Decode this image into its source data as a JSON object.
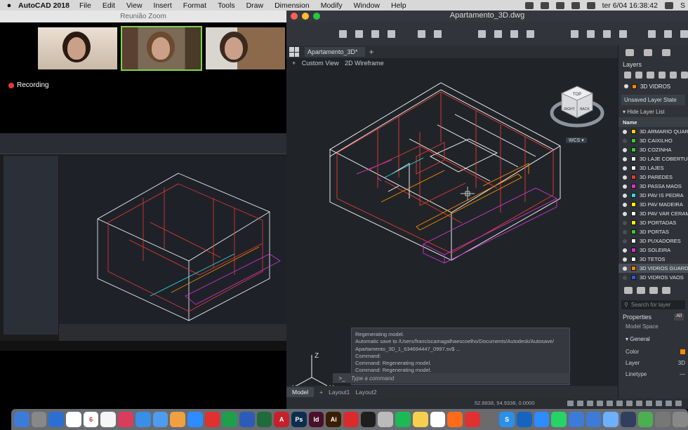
{
  "menubar": {
    "app_name": "AutoCAD 2018",
    "menus": [
      "File",
      "Edit",
      "View",
      "Insert",
      "Format",
      "Tools",
      "Draw",
      "Dimension",
      "Modify",
      "Window",
      "Help"
    ],
    "datetime": "ter 6/04  16:38:42",
    "user": "S"
  },
  "zoom": {
    "title": "Reunião Zoom",
    "recording_label": "Recording"
  },
  "acad": {
    "window_title": "Apartamento_3D.dwg",
    "tab_name": "Apartamento_3D*",
    "viewport_labels": [
      "Custom View",
      "2D Wireframe"
    ],
    "viewcube_top": "TOP",
    "viewcube_front": "FRONT",
    "viewcube_right": "RIGHT",
    "viewcube_back": "BACK",
    "wcs": "WCS",
    "ucs_x": "X",
    "ucs_y": "Y",
    "ucs_z": "Z",
    "command_history": [
      "Regenerating model.",
      "Automatic save to /Users/franciscamagalhaescoelho/Documents/Autodesk/Autosave/",
      "Apartamento_3D_1_634694447_0997.sv$ ...",
      "Command:",
      "Command:  Regenerating model.",
      "Command:  Regenerating model."
    ],
    "command_placeholder": "Type a command",
    "layout_tabs": [
      "Model",
      "Layout1",
      "Layout2"
    ],
    "coords": "52.8838, 54.9338, 0.0000"
  },
  "layers": {
    "title": "Layers",
    "current_layer": "3D VIDROS",
    "layer_state": "Unsaved Layer State",
    "hide_list": "Hide Layer List",
    "name_header": "Name",
    "items": [
      {
        "name": "3D ARMARIO QUAR",
        "color": "#ffcc00",
        "on": true
      },
      {
        "name": "3D CAIXILHO",
        "color": "#33cc33",
        "on": false
      },
      {
        "name": "3D COZINHA",
        "color": "#33cc33",
        "on": true
      },
      {
        "name": "3D LAJE COBERTUR",
        "color": "#ffffff",
        "on": true
      },
      {
        "name": "3D LAJES",
        "color": "#ffffff",
        "on": true
      },
      {
        "name": "3D PAREDES",
        "color": "#e53935",
        "on": true
      },
      {
        "name": "3D PASSA MAOS",
        "color": "#d633d6",
        "on": true
      },
      {
        "name": "3D PAV IS PEDRA",
        "color": "#33d6e0",
        "on": true
      },
      {
        "name": "3D PAV MADEIRA",
        "color": "#ffee00",
        "on": true
      },
      {
        "name": "3D PAV VAR CERAM",
        "color": "#ffffff",
        "on": true
      },
      {
        "name": "3D PORTADAS",
        "color": "#ffee00",
        "on": false
      },
      {
        "name": "3D PORTAS",
        "color": "#33cc33",
        "on": false
      },
      {
        "name": "3D PUXADORES",
        "color": "#ffffff",
        "on": false
      },
      {
        "name": "3D SOLEIRA",
        "color": "#d633d6",
        "on": true
      },
      {
        "name": "3D TETOS",
        "color": "#ffffff",
        "on": true
      },
      {
        "name": "3D VIDROS GUARD",
        "color": "#ff8800",
        "on": true,
        "selected": true
      },
      {
        "name": "3D VIDROS VAOS",
        "color": "#2f5bd6",
        "on": false
      }
    ],
    "search_placeholder": "Search for layer"
  },
  "properties": {
    "title": "Properties",
    "all_label": "All",
    "model_space": "Model Space",
    "general": "General",
    "rows": [
      {
        "label": "Color",
        "value": ""
      },
      {
        "label": "Layer",
        "value": "3D"
      },
      {
        "label": "Linetype",
        "value": "—"
      }
    ]
  },
  "dock": {
    "apps": [
      {
        "label": "",
        "color": "#3d7bd9"
      },
      {
        "label": "",
        "color": "#888"
      },
      {
        "label": "",
        "color": "#2b6fd1"
      },
      {
        "label": "",
        "color": "#ffffff"
      },
      {
        "label": "6",
        "color": "#ffffff"
      },
      {
        "label": "",
        "color": "#f5f5f5"
      },
      {
        "label": "",
        "color": "#d93d5d"
      },
      {
        "label": "",
        "color": "#3a8ee6"
      },
      {
        "label": "",
        "color": "#4d9cf0"
      },
      {
        "label": "",
        "color": "#f0a040"
      },
      {
        "label": "",
        "color": "#2d8cff"
      },
      {
        "label": "",
        "color": "#e03030"
      },
      {
        "label": "",
        "color": "#1f9e4b"
      },
      {
        "label": "",
        "color": "#2b5cb8"
      },
      {
        "label": "",
        "color": "#1f6b3a"
      },
      {
        "label": "A",
        "color": "#c8202a"
      },
      {
        "label": "Ps",
        "color": "#0c2d4e"
      },
      {
        "label": "Id",
        "color": "#4a0f2a"
      },
      {
        "label": "Ai",
        "color": "#3a1e02"
      },
      {
        "label": "",
        "color": "#d92b2b"
      },
      {
        "label": "",
        "color": "#1e1e1e"
      },
      {
        "label": "",
        "color": "#bbbbbb"
      },
      {
        "label": "",
        "color": "#1db954"
      },
      {
        "label": "",
        "color": "#f6d04d"
      },
      {
        "label": "",
        "color": "#ffffff"
      },
      {
        "label": "",
        "color": "#ff6b1a"
      },
      {
        "label": "",
        "color": "#e03030"
      },
      {
        "label": "",
        "color": "#6b6b6b"
      },
      {
        "label": "S",
        "color": "#2a90e8"
      },
      {
        "label": "",
        "color": "#1565c0"
      },
      {
        "label": "",
        "color": "#2d8cff"
      },
      {
        "label": "",
        "color": "#25d366"
      },
      {
        "label": "",
        "color": "#3d7bd9"
      },
      {
        "label": "",
        "color": "#3d7bd9"
      },
      {
        "label": "",
        "color": "#6cb0ff"
      },
      {
        "label": "",
        "color": "#2f3f5c"
      },
      {
        "label": "",
        "color": "#4caf50"
      },
      {
        "label": "",
        "color": "#777777"
      },
      {
        "label": "",
        "color": "#888888"
      }
    ]
  },
  "colors": {
    "walls": "#e53935",
    "white": "#ffffff",
    "orange": "#ff8800",
    "magenta": "#d633d6"
  }
}
